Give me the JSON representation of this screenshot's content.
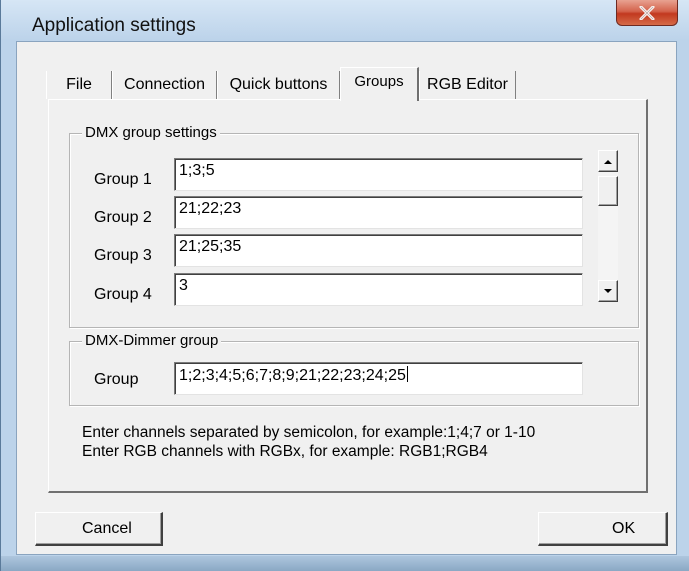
{
  "window": {
    "title": "Application settings",
    "close_glyph": "✕"
  },
  "tabs": [
    {
      "label": "File",
      "active": false
    },
    {
      "label": "Connection",
      "active": false
    },
    {
      "label": "Quick buttons",
      "active": false
    },
    {
      "label": "Groups",
      "active": true
    },
    {
      "label": "RGB Editor",
      "active": false
    }
  ],
  "dmx_group_settings": {
    "legend": "DMX group settings",
    "groups": [
      {
        "label": "Group 1",
        "value": "1;3;5"
      },
      {
        "label": "Group 2",
        "value": "21;22;23"
      },
      {
        "label": "Group 3",
        "value": "21;25;35"
      },
      {
        "label": "Group 4",
        "value": "3"
      }
    ],
    "scroll_up_icon": "up-arrow",
    "scroll_down_icon": "down-arrow"
  },
  "dmx_dimmer_group": {
    "legend": "DMX-Dimmer group",
    "label": "Group",
    "value": "1;2;3;4;5;6;7;8;9;21;22;23;24;25"
  },
  "hints": {
    "line1": "Enter channels separated by semicolon, for example:1;4;7 or 1-10",
    "line2": "Enter RGB channels with RGBx, for example: RGB1;RGB4"
  },
  "buttons": {
    "cancel": "Cancel",
    "ok": "OK"
  },
  "colors": {
    "frame": "#bcd3ea",
    "client": "#f0f0f0",
    "close_button": "#c7452a"
  }
}
